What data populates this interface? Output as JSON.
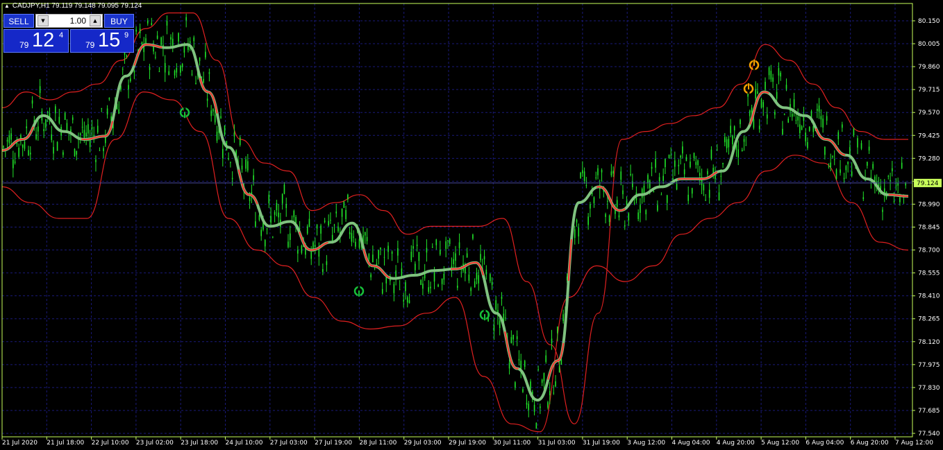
{
  "header": {
    "symbol_info": "CADJPY,H1  79.119 79.148 79.095 79.124"
  },
  "trade_panel": {
    "sell_label": "SELL",
    "buy_label": "BUY",
    "lot_value": "1.00",
    "sell_small": "79",
    "sell_big": "12",
    "sell_pip": "4",
    "buy_small": "79",
    "buy_big": "15",
    "buy_pip": "9"
  },
  "chart_data": {
    "type": "line",
    "symbol": "CADJPY",
    "timeframe": "H1",
    "ylim": [
      77.54,
      80.2
    ],
    "current_price": "79.124",
    "y_ticks": [
      "80.150",
      "80.005",
      "79.860",
      "79.715",
      "79.570",
      "79.425",
      "79.280",
      "79.135",
      "78.990",
      "78.845",
      "78.700",
      "78.555",
      "78.410",
      "78.265",
      "78.120",
      "77.975",
      "77.830",
      "77.685",
      "77.540"
    ],
    "x_ticks": [
      "21 Jul 2020",
      "21 Jul 18:00",
      "22 Jul 10:00",
      "23 Jul 02:00",
      "23 Jul 18:00",
      "24 Jul 10:00",
      "27 Jul 03:00",
      "27 Jul 19:00",
      "28 Jul 11:00",
      "29 Jul 03:00",
      "29 Jul 19:00",
      "30 Jul 11:00",
      "31 Jul 03:00",
      "31 Jul 19:00",
      "3 Aug 12:00",
      "4 Aug 04:00",
      "4 Aug 20:00",
      "5 Aug 12:00",
      "6 Aug 04:00",
      "6 Aug 20:00",
      "7 Aug 12:00"
    ],
    "middle": [
      79.33,
      79.4,
      79.55,
      79.45,
      79.4,
      79.42,
      79.8,
      80.0,
      79.98,
      80.0,
      79.7,
      79.35,
      79.05,
      78.85,
      78.88,
      78.7,
      78.75,
      78.87,
      78.6,
      78.52,
      78.54,
      78.57,
      78.58,
      78.62,
      78.3,
      77.95,
      77.75,
      78.0,
      79.0,
      79.1,
      78.95,
      79.05,
      79.1,
      79.15,
      79.15,
      79.2,
      79.45,
      79.7,
      79.6,
      79.55,
      79.4,
      79.3,
      79.15,
      79.05,
      79.04
    ],
    "upper": [
      79.6,
      79.7,
      79.65,
      79.7,
      79.75,
      79.9,
      80.1,
      80.2,
      80.2,
      79.9,
      79.4,
      79.25,
      79.2,
      78.95,
      79.0,
      79.05,
      78.95,
      78.8,
      78.85,
      78.85,
      78.85,
      78.9,
      78.5,
      78.1,
      77.6,
      78.3,
      79.4,
      79.45,
      79.5,
      79.55,
      79.6,
      79.75,
      80.0,
      79.9,
      79.75,
      79.6,
      79.45,
      79.4,
      79.4
    ],
    "lower": [
      79.1,
      79.0,
      78.9,
      78.9,
      79.4,
      79.7,
      79.65,
      79.45,
      78.9,
      78.7,
      78.6,
      78.4,
      78.25,
      78.2,
      78.22,
      78.3,
      78.4,
      77.9,
      77.6,
      77.55,
      78.4,
      78.6,
      78.5,
      78.6,
      78.8,
      78.9,
      79.0,
      79.2,
      79.3,
      79.25,
      79.0,
      78.75,
      78.7
    ],
    "arrows": [
      {
        "label": "buy",
        "price": 79.57,
        "color": "#17c03a"
      },
      {
        "label": "buy",
        "price": 78.44,
        "color": "#17c03a"
      },
      {
        "label": "buy",
        "price": 78.29,
        "color": "#17c03a"
      },
      {
        "label": "sell",
        "price": 79.72,
        "color": "#f5a000"
      },
      {
        "label": "sell",
        "price": 79.87,
        "color": "#f5a000"
      }
    ],
    "colors": {
      "candles": "#21e62a",
      "bands": "#e02020",
      "ma_down": "#ff3030",
      "ma_up": "#7fc27f",
      "grid": "#1a1a7a",
      "axis": "#c8ff5a",
      "price_label_bg": "#c8ff5a"
    }
  }
}
